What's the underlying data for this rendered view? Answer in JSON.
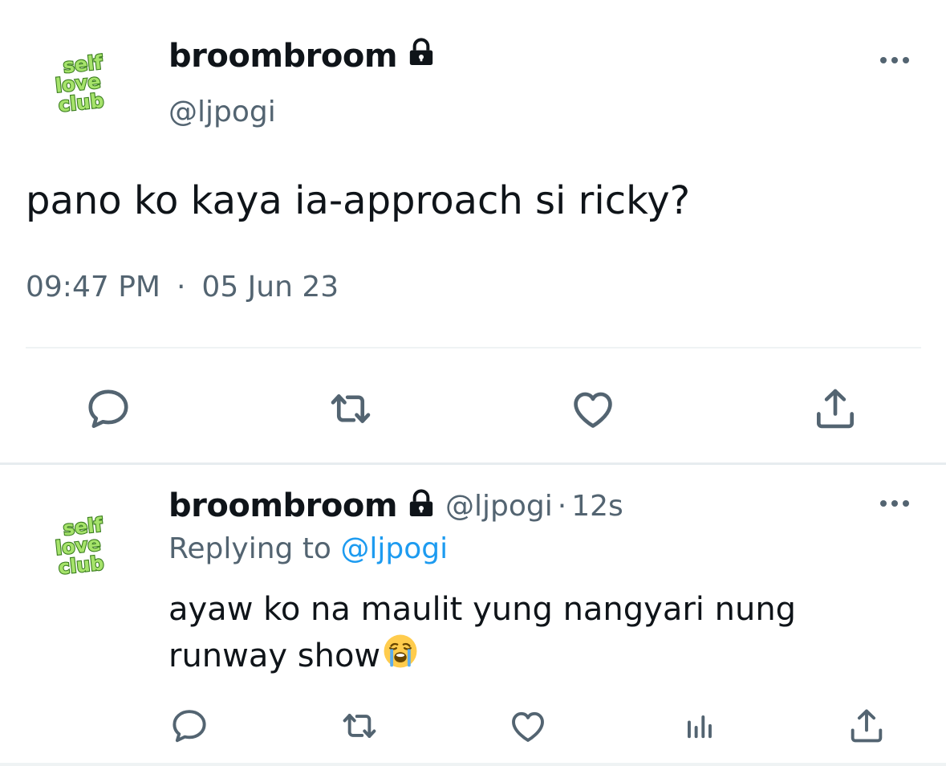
{
  "main_tweet": {
    "display_name": "broombroom",
    "handle": "@ljpogi",
    "text": "pano ko kaya ia-approach si ricky?",
    "time": "09:47 PM",
    "separator": "·",
    "date": "05 Jun 23",
    "avatar_lines": [
      "self",
      "love",
      "club"
    ],
    "icons": {
      "protected": "lock-icon",
      "more": "more-options-icon",
      "actions": [
        "reply-icon",
        "retweet-icon",
        "like-icon",
        "share-icon"
      ]
    }
  },
  "reply_tweet": {
    "display_name": "broombroom",
    "handle": "@ljpogi",
    "dot": "·",
    "time_ago": "12s",
    "replying_prefix": "Replying to",
    "replying_to": "@ljpogi",
    "text": "ayaw ko na maulit yung nangyari nung runway show",
    "emoji": "loudly-crying-face-icon",
    "avatar_lines": [
      "self",
      "love",
      "club"
    ],
    "icons": {
      "protected": "lock-icon",
      "more": "more-options-icon",
      "actions": [
        "reply-icon",
        "retweet-icon",
        "like-icon",
        "analytics-icon",
        "share-icon"
      ]
    }
  },
  "colors": {
    "text": "#0f1419",
    "secondary": "#536471",
    "link": "#1d9bf0",
    "avatar_green": "#7ed957",
    "avatar_dark": "#3a7d1e"
  }
}
